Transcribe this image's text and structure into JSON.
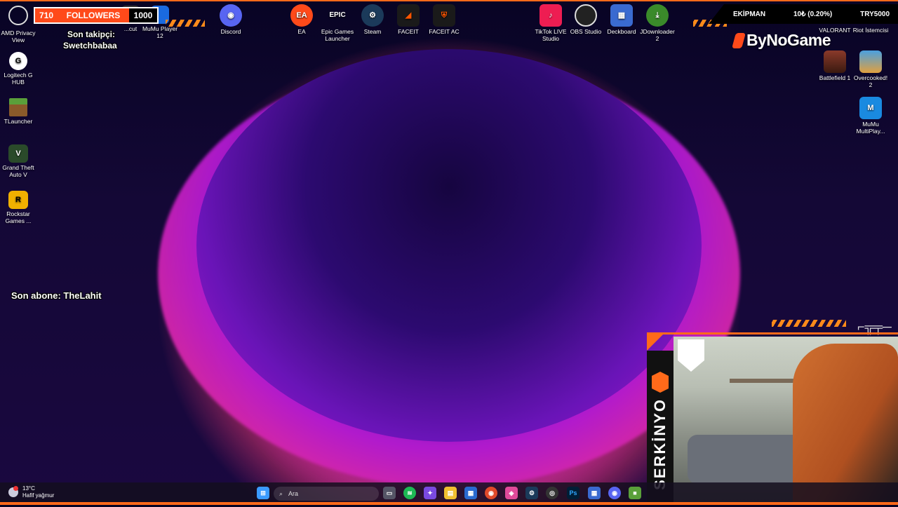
{
  "overlay": {
    "followers": {
      "current": "710",
      "label": "FOLLOWERS",
      "goal": "1000"
    },
    "last_follower": {
      "label": "Son takipçi:",
      "name": "Swetchbabaa"
    },
    "last_sub": "Son abone: TheLahit",
    "ticker": {
      "label": "EKİPMAN",
      "change": "10₺ (0.20%)",
      "code": "TRY5000"
    },
    "sponsor": "ByNoGame",
    "streamer_name": "SERKİNYO"
  },
  "desktop_left": [
    {
      "label": "AMD Privacy View",
      "icon": "amd-privacy-icon"
    },
    {
      "label": "Logitech G HUB",
      "icon": "logitech-ghub-icon"
    },
    {
      "label": "TLauncher",
      "icon": "tlauncher-icon"
    },
    {
      "label": "Grand Theft Auto V",
      "icon": "gta5-icon"
    },
    {
      "label": "Rockstar Games ...",
      "icon": "rockstar-icon"
    }
  ],
  "desktop_top": [
    {
      "label": "...cut",
      "icon": "shortcut-icon"
    },
    {
      "label": "MuMu Player 12",
      "icon": "mumu-player-icon"
    },
    {
      "label": "Discord",
      "icon": "discord-icon"
    },
    {
      "label": "EA",
      "icon": "ea-icon"
    },
    {
      "label": "Epic Games Launcher",
      "icon": "epic-games-icon"
    },
    {
      "label": "Steam",
      "icon": "steam-icon"
    },
    {
      "label": "FACEIT",
      "icon": "faceit-icon"
    },
    {
      "label": "FACEIT AC",
      "icon": "faceit-ac-icon"
    },
    {
      "label": "TikTok LIVE Studio",
      "icon": "tiktok-live-icon"
    },
    {
      "label": "OBS Studio",
      "icon": "obs-icon"
    },
    {
      "label": "Deckboard",
      "icon": "deckboard-icon"
    },
    {
      "label": "JDownloader 2",
      "icon": "jdownloader-icon"
    }
  ],
  "desktop_right": [
    {
      "label": "VALORANT",
      "icon": "valorant-icon"
    },
    {
      "label": "Riot İstemcisi",
      "icon": "riot-client-icon"
    },
    {
      "label": "Battlefield 1",
      "icon": "battlefield-icon"
    },
    {
      "label": "Overcooked! 2",
      "icon": "overcooked-icon"
    },
    {
      "label": "MuMu MultiPlay...",
      "icon": "mumu-multiplayer-icon"
    }
  ],
  "taskbar": {
    "weather_temp": "13°C",
    "weather_desc": "Hafif yağmur",
    "search_placeholder": "Ara"
  }
}
